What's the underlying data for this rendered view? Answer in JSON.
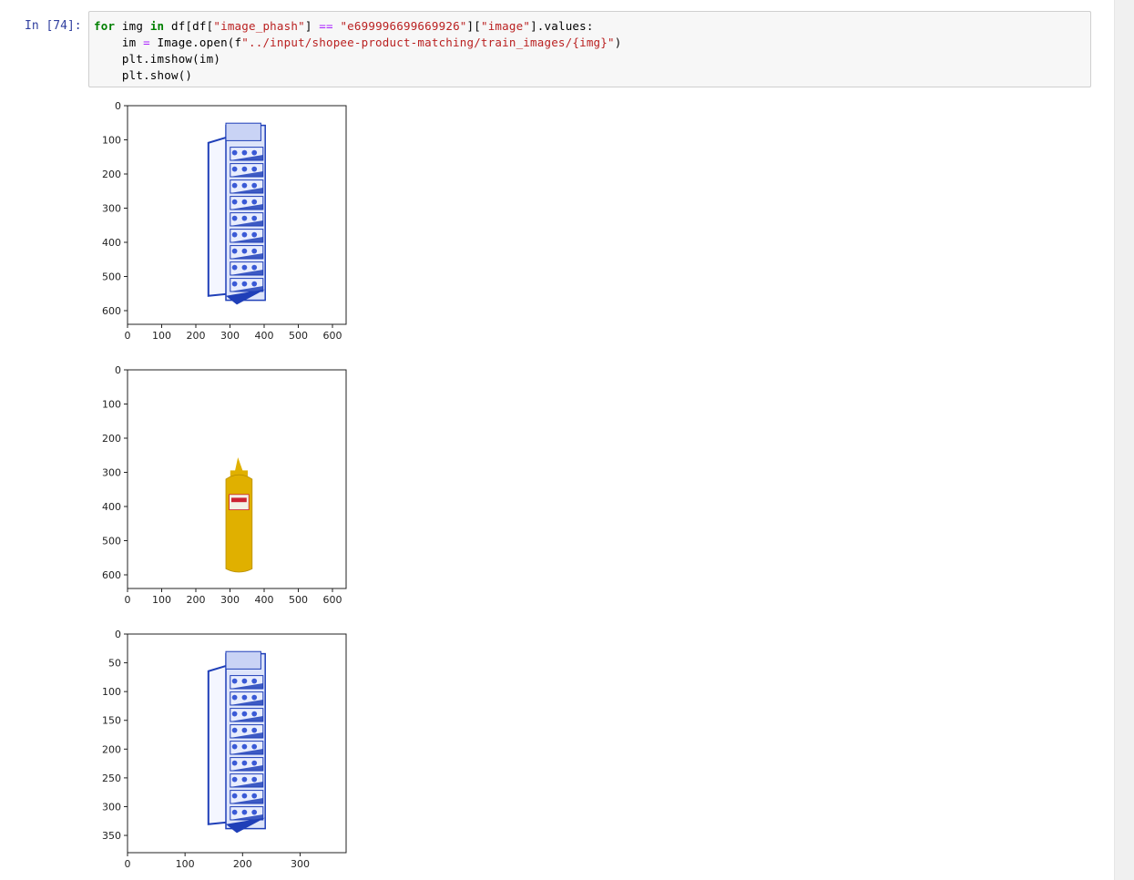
{
  "cell": {
    "prompt": "In [74]:",
    "code_lines": [
      [
        {
          "t": "kw",
          "v": "for"
        },
        {
          "t": "p",
          "v": " img "
        },
        {
          "t": "kw",
          "v": "in"
        },
        {
          "t": "p",
          "v": " df[df["
        },
        {
          "t": "str",
          "v": "\"image_phash\""
        },
        {
          "t": "p",
          "v": "] "
        },
        {
          "t": "op",
          "v": "=="
        },
        {
          "t": "p",
          "v": " "
        },
        {
          "t": "str",
          "v": "\"e699996699669926\""
        },
        {
          "t": "p",
          "v": "]["
        },
        {
          "t": "str",
          "v": "\"image\""
        },
        {
          "t": "p",
          "v": "].values:"
        }
      ],
      [
        {
          "t": "p",
          "v": "    im "
        },
        {
          "t": "op",
          "v": "="
        },
        {
          "t": "p",
          "v": " Image.open(f"
        },
        {
          "t": "str",
          "v": "\"../input/shopee-product-matching/train_images/{img}\""
        },
        {
          "t": "p",
          "v": ")"
        }
      ],
      [
        {
          "t": "p",
          "v": "    plt.imshow(im)"
        }
      ],
      [
        {
          "t": "p",
          "v": "    plt.show()"
        }
      ]
    ]
  },
  "outputs": [
    {
      "id": "figure-1",
      "content": "shoe-rack",
      "x_ticks": [
        "0",
        "100",
        "200",
        "300",
        "400",
        "500",
        "600"
      ],
      "y_ticks": [
        "0",
        "100",
        "200",
        "300",
        "400",
        "500",
        "600"
      ],
      "x_range": [
        0,
        640
      ],
      "y_range": [
        0,
        640
      ],
      "x_tick_values": [
        0,
        100,
        200,
        300,
        400,
        500,
        600
      ],
      "y_tick_values": [
        0,
        100,
        200,
        300,
        400,
        500,
        600
      ]
    },
    {
      "id": "figure-2",
      "content": "mustard-bottle",
      "x_ticks": [
        "0",
        "100",
        "200",
        "300",
        "400",
        "500",
        "600"
      ],
      "y_ticks": [
        "0",
        "100",
        "200",
        "300",
        "400",
        "500",
        "600"
      ],
      "x_range": [
        0,
        640
      ],
      "y_range": [
        0,
        640
      ],
      "x_tick_values": [
        0,
        100,
        200,
        300,
        400,
        500,
        600
      ],
      "y_tick_values": [
        0,
        100,
        200,
        300,
        400,
        500,
        600
      ]
    },
    {
      "id": "figure-3",
      "content": "shoe-rack",
      "x_ticks": [
        "0",
        "100",
        "200",
        "300"
      ],
      "y_ticks": [
        "0",
        "50",
        "100",
        "150",
        "200",
        "250",
        "300",
        "350"
      ],
      "x_range": [
        0,
        380
      ],
      "y_range": [
        0,
        380
      ],
      "x_tick_values": [
        0,
        100,
        200,
        300
      ],
      "y_tick_values": [
        0,
        50,
        100,
        150,
        200,
        250,
        300,
        350
      ]
    }
  ],
  "colors": {
    "prompt": "#303f9f",
    "keyword": "#008000",
    "operator": "#aa22ff",
    "string": "#ba2121",
    "rack_blue": "#1f3fb8",
    "mustard": "#e0b000"
  }
}
